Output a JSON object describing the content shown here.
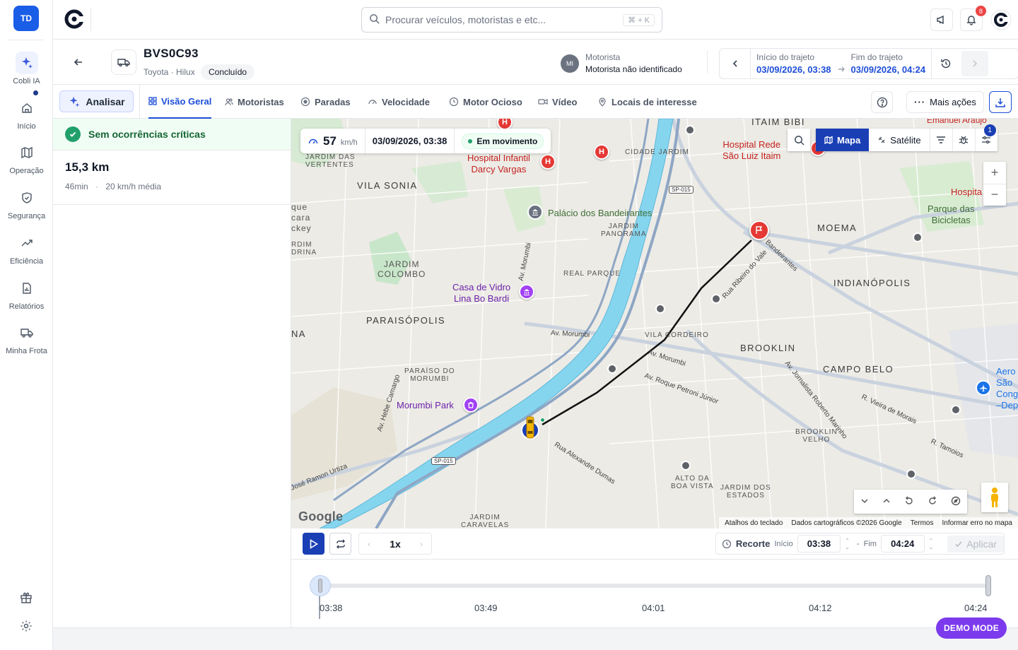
{
  "sidebar": {
    "user_initials": "TD",
    "items": [
      {
        "label": "Cobli IA"
      },
      {
        "label": "Início"
      },
      {
        "label": "Operação"
      },
      {
        "label": "Segurança"
      },
      {
        "label": "Eficiência"
      },
      {
        "label": "Relatórios"
      },
      {
        "label": "Minha Frota"
      }
    ]
  },
  "topbar": {
    "search_placeholder": "Procurar veículos, motoristas e etc...",
    "search_shortcut": "⌘ + K",
    "notifications_count": "8"
  },
  "vehicle": {
    "plate": "BVS0C93",
    "model": "Toyota · Hilux",
    "status": "Concluído",
    "driver_initials": "MI",
    "driver_label": "Motorista",
    "driver_value": "Motorista não identificado"
  },
  "trip": {
    "start_label": "Início do trajeto",
    "start_value": "03/09/2026, 03:38",
    "end_label": "Fim do trajeto",
    "end_value": "03/09/2026, 04:24"
  },
  "tabs": {
    "analyze_label": "Analisar",
    "items": [
      {
        "label": "Visão Geral"
      },
      {
        "label": "Motoristas"
      },
      {
        "label": "Paradas"
      },
      {
        "label": "Velocidade"
      },
      {
        "label": "Motor Ocioso"
      },
      {
        "label": "Vídeo"
      },
      {
        "label": "Locais de interesse"
      }
    ],
    "more_actions": "Mais ações"
  },
  "summary": {
    "status_text": "Sem ocorrências críticas",
    "distance": "15,3 km",
    "duration": "46min",
    "avg_speed": "20 km/h média"
  },
  "map": {
    "speed_value": "57",
    "speed_unit": "km/h",
    "timestamp": "03/09/2026, 03:38",
    "movement": "Em movimento",
    "map_type_map": "Mapa",
    "map_type_sat": "Satélite",
    "filter_badge": "1",
    "google": "Google",
    "attribution": [
      "Atalhos do teclado",
      "Dados cartográficos ©2026 Google",
      "Termos",
      "Informar erro no mapa"
    ],
    "labels": {
      "vila_sonia": "VILA SONIA",
      "jardim_colombo": "JARDIM\nCOLOMBO",
      "paraisopolis": "PARAISÓPOLIS",
      "moema": "MOEMA",
      "indianopolis": "INDIANÓPOLIS",
      "brooklin": "BROOKLIN",
      "campo_belo": "CAMPO BELO",
      "itaim_bibi": "ITAIM BIBI",
      "jardim_das_vertentes": "JARDIM DAS\nVERTENTES",
      "cidade_jardim": "CIDADE JARDIM",
      "jardim_panorama": "JARDIM\nPANORAMA",
      "real_parque": "REAL PARQUE",
      "vila_cordeiro": "VILA CORDEIRO",
      "paraiso_morumbi": "PARAÍSO DO\nMORUMBI",
      "brooklin_velho": "BROOKLIN\nVELHO",
      "alto_boa_vista": "ALTO DA\nBOA VISTA",
      "jardim_dos_estados": "JARDIM DOS\nESTADOS",
      "jardim_caravelas": "JARDIM\nCARAVELAS",
      "palacio": "Palácio dos Bandeirantes",
      "casa_vidro": "Casa de Vidro\nLina Bo Bardi",
      "morumbi_park": "Morumbi Park",
      "parque_bicicletas": "Parque das\nBicicletas",
      "hospital_darcy": "Hospital Infantil\nDarcy Vargas",
      "hospital_sao_luiz": "Hospital Rede\nSão Luiz Itaim",
      "hospital_partial": "Hospita",
      "emanuel": "Emanuel Araújo",
      "aeroporto": "Aero\nSão\nCong\n–Dep",
      "parque_jockey": "que\ncara\nckey",
      "jardim_edge": "RDIM\nDRINA",
      "na": "NA",
      "r_vieira": "R. Vieira de Morais",
      "r_tamoios": "R. Tamoios",
      "av_morumbi": "Av. Morumbi",
      "av_morumbi2": "Av. Morumbi",
      "av_morumbi3": "Av. Morumbi",
      "av_roque": "Av. Roque Petroni Júnior",
      "rua_alexandre": "Rua Alexandre Dumas",
      "rua_ribeiro": "Rua Ribeiro do Vale",
      "bandeirantes": "Bandeirantes",
      "av_jornalista": "Av. Jornalista Roberto Marinho",
      "av_hebe": "Av. Hebe Camargo",
      "jose_ramon": "José Ramon Urtiza",
      "sp015": "SP-015",
      "sp015b": "SP-015"
    }
  },
  "playback": {
    "speed": "1x",
    "clip_label": "Recorte",
    "start_label": "Início",
    "start_value": "03:38",
    "end_label": "Fim",
    "end_value": "04:24",
    "apply_label": "Aplicar"
  },
  "timeline": {
    "ticks": [
      "03:38",
      "03:49",
      "04:01",
      "04:12",
      "04:24"
    ],
    "progress": 0
  },
  "demo_mode": "DEMO MODE",
  "colors": {
    "primary": "#1a3fb5",
    "accent_blue": "#1d4ed8",
    "success": "#22a06b",
    "demo": "#7c3aed",
    "river": "#7fd1ea"
  }
}
